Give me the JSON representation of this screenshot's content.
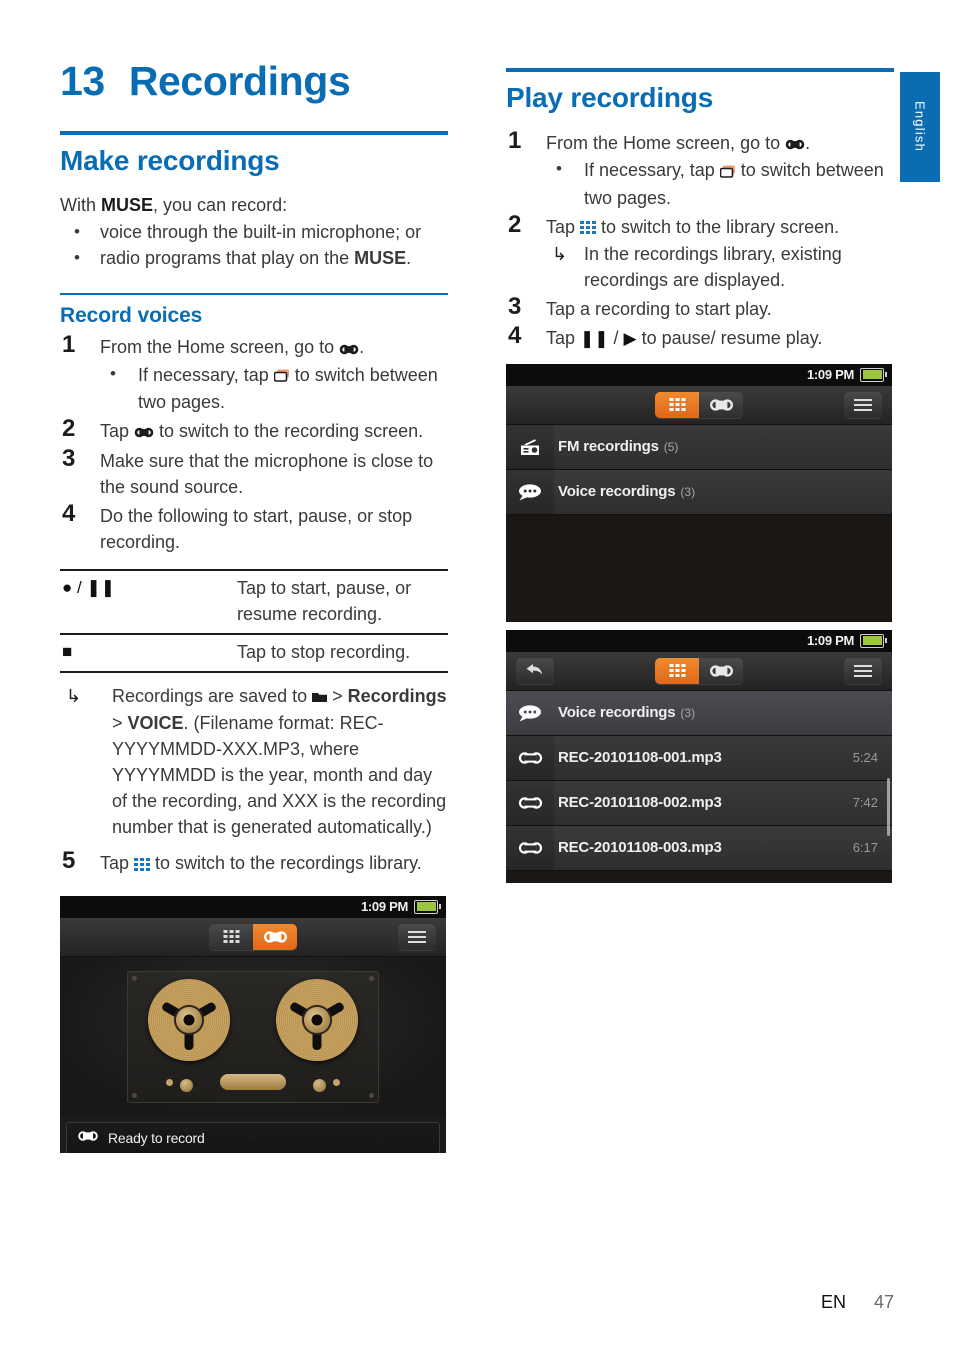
{
  "chapter": {
    "number": "13",
    "title": "Recordings"
  },
  "side_tab": {
    "label": "English"
  },
  "footer": {
    "lang": "EN",
    "page": "47"
  },
  "left": {
    "section_title": "Make recordings",
    "intro": {
      "prefix": "With ",
      "brand": "MUSE",
      "suffix": ", you can record:"
    },
    "intro_bullets": [
      "voice through the built-in microphone; or",
      "radio programs that play on the MUSE."
    ],
    "subsection_title": "Record voices",
    "steps": [
      {
        "n": "1",
        "text": "From the Home screen, go to ∞.",
        "subs": [
          {
            "type": "bullet",
            "text": "If necessary, tap ❐ to switch between two pages."
          }
        ]
      },
      {
        "n": "2",
        "text": "Tap ∞ to switch to the recording screen.",
        "subs": []
      },
      {
        "n": "3",
        "text": "Make sure that the microphone is close to the sound source.",
        "subs": []
      },
      {
        "n": "4",
        "text": "Do the following to start, pause, or stop recording.",
        "subs": []
      }
    ],
    "table": {
      "rows": [
        {
          "key": "● / ❚❚",
          "value": "Tap to start, pause, or resume recording."
        },
        {
          "key": "■",
          "value": "Tap to stop recording."
        }
      ]
    },
    "note": {
      "lead": "Recordings are saved to ",
      "folder_icon": "◥",
      "path1": "Recordings",
      "sep": " > ",
      "path2": "VOICE",
      "body": ". (Filename format: REC-YYYYMMDD-XXX.MP3, where YYYYMMDD is the year, month and day of the recording, and XXX is the recording number that is generated automatically.)"
    },
    "step5": {
      "n": "5",
      "text": "Tap ☷ to switch to the recordings library."
    }
  },
  "right": {
    "section_title": "Play recordings",
    "steps": [
      {
        "n": "1",
        "text": "From the Home screen, go to ∞.",
        "subs": [
          {
            "type": "bullet",
            "text": "If necessary, tap ❐ to switch between two pages."
          }
        ]
      },
      {
        "n": "2",
        "text": "Tap ☷ to switch to the library screen.",
        "subs": [
          {
            "type": "arrow",
            "text": "In the recordings library, existing recordings are displayed."
          }
        ]
      },
      {
        "n": "3",
        "text": "Tap a recording to start play.",
        "subs": []
      },
      {
        "n": "4",
        "text": "Tap ❚❚ / ▶ to pause/ resume play.",
        "subs": []
      }
    ]
  },
  "screens": {
    "library": {
      "clock": "1:09 PM",
      "tabs": [
        {
          "name": "library-tab",
          "icon": "grid-icon",
          "active": true
        },
        {
          "name": "recorder-tab",
          "icon": "cassette-icon",
          "active": false
        }
      ],
      "menu_icon": "hamburger-icon",
      "rows": [
        {
          "icon": "radio-icon",
          "label": "FM recordings",
          "count": "(5)"
        },
        {
          "icon": "speech-bubble-icon",
          "label": "Voice recordings",
          "count": "(3)"
        }
      ]
    },
    "voice_list": {
      "clock": "1:09 PM",
      "back_icon": "back-arrow-icon",
      "tabs": [
        {
          "name": "library-tab",
          "icon": "grid-icon",
          "active": true
        },
        {
          "name": "recorder-tab",
          "icon": "cassette-icon",
          "active": false
        }
      ],
      "menu_icon": "hamburger-icon",
      "header": {
        "icon": "speech-bubble-icon",
        "label": "Voice recordings",
        "count": "(3)"
      },
      "items": [
        {
          "icon": "cassette-icon",
          "name": "REC-20101108-001.mp3",
          "duration": "5:24"
        },
        {
          "icon": "cassette-icon",
          "name": "REC-20101108-002.mp3",
          "duration": "7:42"
        },
        {
          "icon": "cassette-icon",
          "name": "REC-20101108-003.mp3",
          "duration": "6:17"
        }
      ]
    },
    "recorder": {
      "clock": "1:09 PM",
      "tabs": [
        {
          "name": "library-tab",
          "icon": "grid-icon",
          "active": false
        },
        {
          "name": "recorder-tab",
          "icon": "cassette-icon",
          "active": true
        }
      ],
      "menu_icon": "hamburger-icon",
      "status_text": "Ready to record",
      "status_icon": "cassette-icon",
      "transport": [
        {
          "name": "record-button",
          "icon": "record-circle-icon"
        },
        {
          "name": "stop-button",
          "icon": "stop-square-icon"
        },
        {
          "name": "previous-button",
          "icon": "skip-back-icon"
        },
        {
          "name": "play-button",
          "icon": "play-icon"
        },
        {
          "name": "next-button",
          "icon": "skip-forward-icon"
        }
      ]
    }
  },
  "colors": {
    "brand_blue": "#0a6db4",
    "accent_orange": "#e8731e",
    "record_red": "#cc2229",
    "battery_green": "#9ec63b"
  }
}
